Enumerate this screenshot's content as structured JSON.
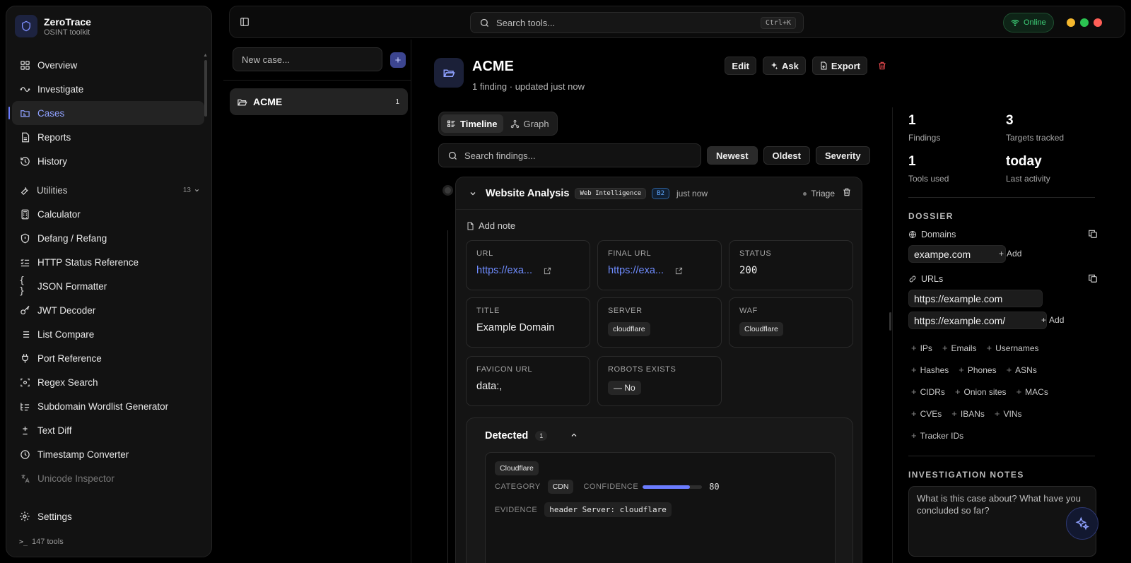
{
  "brand": {
    "name": "ZeroTrace",
    "subtitle": "OSINT toolkit"
  },
  "nav": {
    "primary": [
      {
        "label": "Overview",
        "icon": "grid-icon"
      },
      {
        "label": "Investigate",
        "icon": "activity-icon"
      },
      {
        "label": "Cases",
        "icon": "folder-icon",
        "active": true
      },
      {
        "label": "Reports",
        "icon": "file-icon"
      },
      {
        "label": "History",
        "icon": "history-icon"
      }
    ],
    "utilities_label": "Utilities",
    "utilities_count": "13",
    "utilities": [
      {
        "label": "Calculator",
        "icon": "calculator-icon"
      },
      {
        "label": "Defang / Refang",
        "icon": "shield-icon"
      },
      {
        "label": "HTTP Status Reference",
        "icon": "list-check-icon"
      },
      {
        "label": "JSON Formatter",
        "icon": "braces-icon"
      },
      {
        "label": "JWT Decoder",
        "icon": "key-icon"
      },
      {
        "label": "List Compare",
        "icon": "list-icon"
      },
      {
        "label": "Port Reference",
        "icon": "plug-icon"
      },
      {
        "label": "Regex Search",
        "icon": "regex-icon"
      },
      {
        "label": "Subdomain Wordlist Generator",
        "icon": "wordlist-icon"
      },
      {
        "label": "Text Diff",
        "icon": "diff-icon"
      },
      {
        "label": "Timestamp Converter",
        "icon": "clock-icon"
      },
      {
        "label": "Unicode Inspector",
        "icon": "translate-icon"
      }
    ],
    "settings": "Settings",
    "tools_count": "147 tools"
  },
  "topbar": {
    "search_placeholder": "Search tools...",
    "shortcut": "Ctrl+K",
    "status": "Online",
    "window_dots": [
      "#f5b82e",
      "#2bc451",
      "#ff5f57"
    ]
  },
  "cases": {
    "new_placeholder": "New case...",
    "items": [
      {
        "name": "ACME",
        "count": "1"
      }
    ]
  },
  "case": {
    "title": "ACME",
    "subtitle": "1 finding · updated just now",
    "actions": {
      "edit": "Edit",
      "ask": "Ask",
      "export": "Export"
    },
    "views": [
      "Timeline",
      "Graph"
    ],
    "findings_placeholder": "Search findings...",
    "sort": [
      "Newest",
      "Oldest",
      "Severity"
    ],
    "finding": {
      "title": "Website Analysis",
      "category": "Web Intelligence",
      "badge": "B2",
      "time": "just now",
      "status": "Triage",
      "add_note": "Add note",
      "fields": {
        "url": {
          "label": "URL",
          "value": "https://exa..."
        },
        "final_url": {
          "label": "FINAL URL",
          "value": "https://exa..."
        },
        "status": {
          "label": "STATUS",
          "value": "200"
        },
        "title": {
          "label": "TITLE",
          "value": "Example Domain"
        },
        "server": {
          "label": "SERVER",
          "value": "cloudflare"
        },
        "waf": {
          "label": "WAF",
          "value": "Cloudflare"
        },
        "favicon": {
          "label": "FAVICON URL",
          "value": "data:,"
        },
        "robots": {
          "label": "ROBOTS EXISTS",
          "value": "— No"
        }
      },
      "detected": {
        "label": "Detected",
        "count": "1",
        "item": {
          "name": "Cloudflare",
          "category_label": "CATEGORY",
          "category": "CDN",
          "confidence_label": "CONFIDENCE",
          "confidence": 80,
          "confidence_text": "80",
          "evidence_label": "EVIDENCE",
          "evidence": "header Server: cloudflare"
        }
      }
    }
  },
  "stats": [
    {
      "value": "1",
      "label": "Findings"
    },
    {
      "value": "3",
      "label": "Targets tracked"
    },
    {
      "value": "1",
      "label": "Tools used"
    },
    {
      "value": "today",
      "label": "Last activity"
    }
  ],
  "dossier": {
    "heading": "DOSSIER",
    "domains_label": "Domains",
    "domains": [
      "exampe.com"
    ],
    "urls_label": "URLs",
    "urls": [
      "https://example.com",
      "https://example.com/"
    ],
    "add": "Add",
    "tags": [
      [
        "IPs",
        "Emails",
        "Usernames"
      ],
      [
        "Hashes",
        "Phones",
        "ASNs"
      ],
      [
        "CIDRs",
        "Onion sites",
        "MACs"
      ],
      [
        "CVEs",
        "IBANs",
        "VINs"
      ],
      [
        "Tracker IDs"
      ]
    ]
  },
  "notes": {
    "heading": "INVESTIGATION NOTES",
    "placeholder": "What is this case about? What have you concluded so far?"
  }
}
